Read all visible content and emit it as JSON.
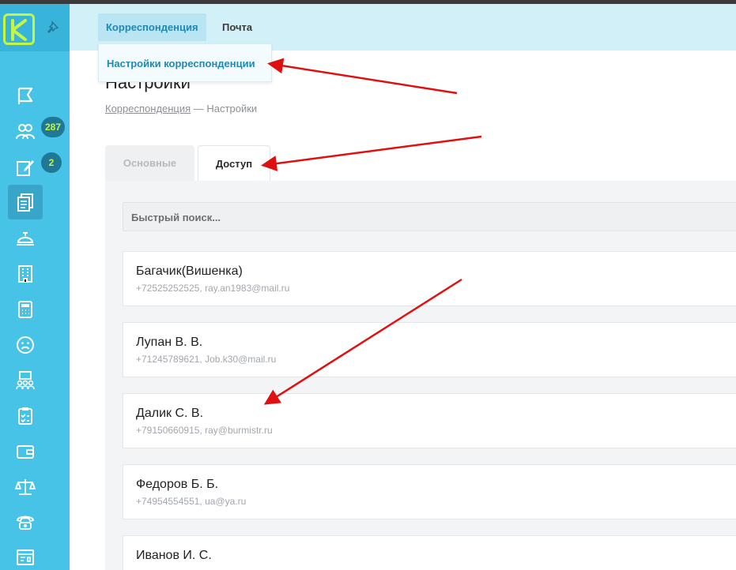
{
  "topbar": {
    "tabs": [
      {
        "label": "Корреспонденция"
      },
      {
        "label": "Почта"
      }
    ]
  },
  "dropdown": {
    "item": "Настройки корреспонденции"
  },
  "page": {
    "title": "Настройки",
    "breadcrumb_link": "Корреспонденция",
    "breadcrumb_sep": " — ",
    "breadcrumb_current": "Настройки"
  },
  "tabs": [
    {
      "label": "Основные"
    },
    {
      "label": "Доступ"
    }
  ],
  "search": {
    "placeholder": "Быстрый поиск..."
  },
  "sidebar": {
    "badges": [
      "287",
      "2"
    ],
    "items": [
      {
        "icon": "flag-icon"
      },
      {
        "icon": "people-icon"
      },
      {
        "icon": "edit-icon"
      },
      {
        "icon": "documents-icon"
      },
      {
        "icon": "service-bell-icon"
      },
      {
        "icon": "building-icon"
      },
      {
        "icon": "calculator-icon"
      },
      {
        "icon": "sad-face-icon"
      },
      {
        "icon": "meeting-icon"
      },
      {
        "icon": "clipboard-check-icon"
      },
      {
        "icon": "wallet-icon"
      },
      {
        "icon": "scales-icon"
      },
      {
        "icon": "phone-icon"
      },
      {
        "icon": "window-icon"
      }
    ]
  },
  "contacts": [
    {
      "name": "Багачик(Вишенка)",
      "contact": "+72525252525, ray.an1983@mail.ru"
    },
    {
      "name": "Лупан В. В.",
      "contact": "+71245789621, Job.k30@mail.ru"
    },
    {
      "name": "Далик С. В.",
      "contact": "+79150660915, ray@burmistr.ru"
    },
    {
      "name": "Федоров Б. Б.",
      "contact": "+74954554551, ua@ya.ru"
    },
    {
      "name": "Иванов И. С.",
      "contact": ""
    }
  ],
  "colors": {
    "sidebar": "#46c3e6",
    "accent": "#1e8ab4",
    "logo": "#c6f542",
    "annotation_arrow": "#e01010"
  }
}
